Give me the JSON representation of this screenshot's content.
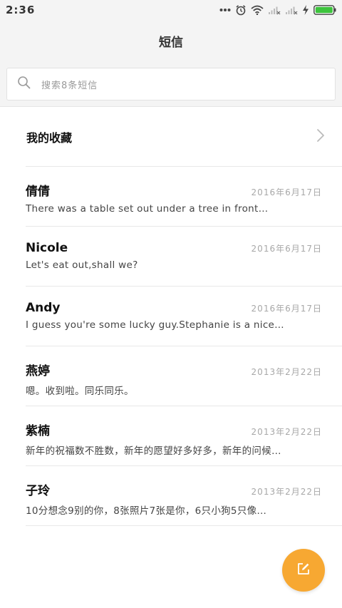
{
  "status_bar": {
    "time": "2:36",
    "icons": [
      "more-dots-icon",
      "alarm-icon",
      "wifi-icon",
      "signal-1-icon",
      "signal-2-icon",
      "charging-icon",
      "battery-icon"
    ],
    "battery_color": "#3dc43d"
  },
  "header": {
    "title": "短信"
  },
  "search": {
    "placeholder": "搜索8条短信",
    "icon": "search-icon"
  },
  "favorites": {
    "label": "我的收藏",
    "icon": "chevron-right-icon"
  },
  "messages": [
    {
      "name": "倩倩",
      "date": "2016年6月17日",
      "preview": "There was a table set out under a tree in front…"
    },
    {
      "name": "Nicole",
      "date": "2016年6月17日",
      "preview": "Let's eat out,shall we?"
    },
    {
      "name": "Andy",
      "date": "2016年6月17日",
      "preview": "I guess you're some lucky guy.Stephanie is a nice…"
    },
    {
      "name": "燕婷",
      "date": "2013年2月22日",
      "preview": "嗯。收到啦。同乐同乐。"
    },
    {
      "name": "紫楠",
      "date": "2013年2月22日",
      "preview": "新年的祝福数不胜数，新年的愿望好多好多，新年的问候…"
    },
    {
      "name": "子玲",
      "date": "2013年2月22日",
      "preview": "10分想念9别的你，8张照片7张是你，6只小狗5只像…"
    }
  ],
  "compose": {
    "icon": "compose-icon",
    "color": "#f7a832"
  }
}
